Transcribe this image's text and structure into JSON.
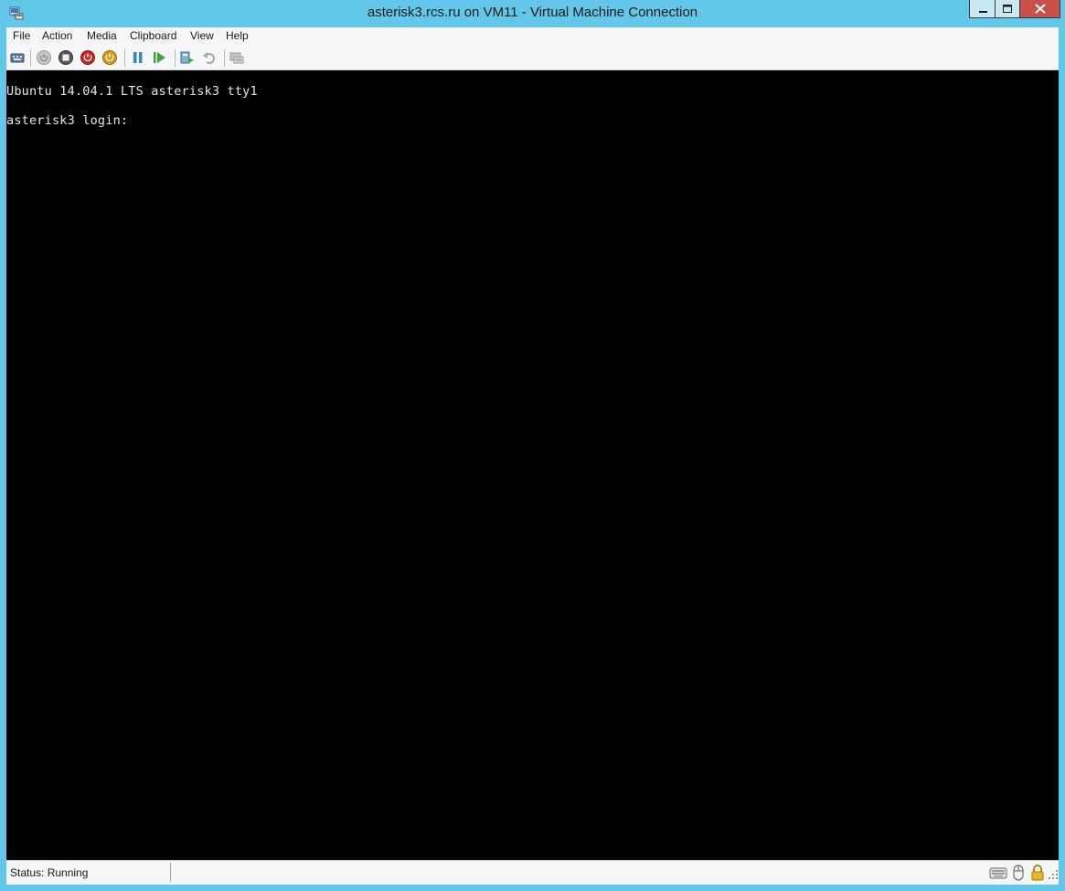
{
  "window": {
    "title": "asterisk3.rcs.ru on VM11 - Virtual Machine Connection"
  },
  "menu": {
    "items": [
      {
        "label": "File"
      },
      {
        "label": "Action"
      },
      {
        "label": "Media"
      },
      {
        "label": "Clipboard"
      },
      {
        "label": "View"
      },
      {
        "label": "Help"
      }
    ]
  },
  "toolbar": {
    "buttons": [
      {
        "icon": "ctrl-alt-del-icon"
      },
      {
        "icon": "start-icon",
        "enabled": false
      },
      {
        "icon": "turn-off-icon"
      },
      {
        "icon": "shut-down-icon"
      },
      {
        "icon": "save-state-icon"
      },
      {
        "icon": "pause-icon"
      },
      {
        "icon": "resume-icon"
      },
      {
        "icon": "checkpoint-icon"
      },
      {
        "icon": "revert-icon",
        "enabled": false
      },
      {
        "icon": "enhanced-session-icon",
        "enabled": false
      }
    ]
  },
  "console": {
    "lines": [
      "Ubuntu 14.04.1 LTS asterisk3 tty1",
      "asterisk3 login:"
    ]
  },
  "status": {
    "text": "Status: Running",
    "indicators": [
      "keyboard-icon",
      "mouse-icon",
      "lock-icon"
    ]
  },
  "colors": {
    "frame": "#63c7e9",
    "close_button": "#c7504a",
    "console_bg": "#000000",
    "console_text": "#e6e6e6"
  }
}
